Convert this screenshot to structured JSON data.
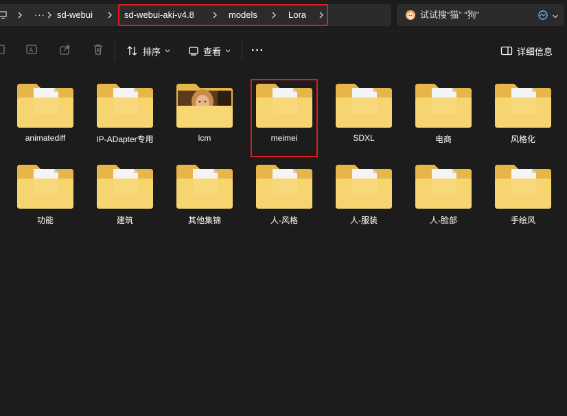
{
  "address": {
    "crumbs": [
      "sd-webui",
      "sd-webui-aki-v4.8",
      "models",
      "Lora"
    ],
    "overflow_label": "···"
  },
  "search": {
    "placeholder": "试试搜“猫” “狗”"
  },
  "toolbar": {
    "sort_label": "排序",
    "view_label": "查看",
    "details_label": "详细信息",
    "more_label": "···"
  },
  "files": {
    "row1": [
      "animatediff",
      "IP-ADapter专用",
      "lcm",
      "meimei",
      "SDXL",
      "电商",
      "风格化"
    ],
    "row2": [
      "功能",
      "建筑",
      "其他集锦",
      "人-风格",
      "人-服装",
      "人-脸部",
      "手绘风"
    ]
  },
  "colors": {
    "highlight": "#e31b1b",
    "folder_back": "#e8b548",
    "folder_front": "#f7d774",
    "background": "#1c1c1c"
  }
}
